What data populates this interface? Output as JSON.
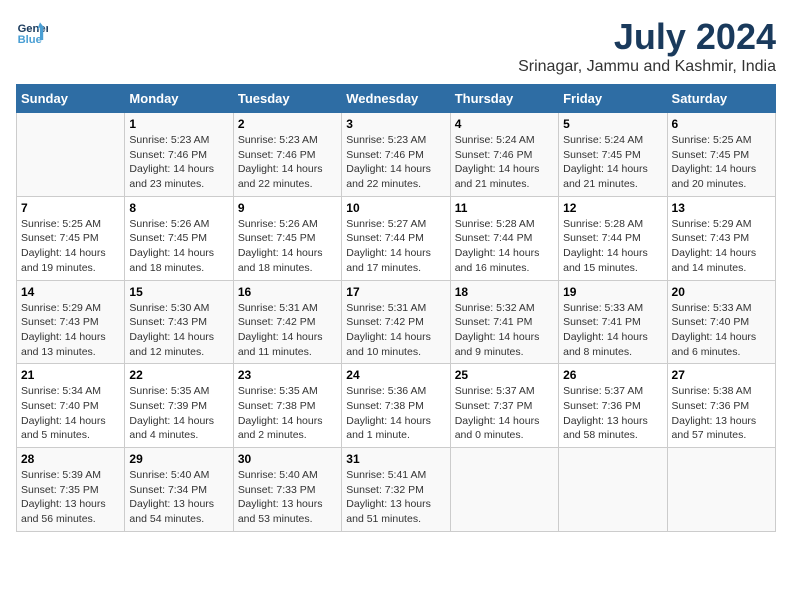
{
  "logo": {
    "line1": "General",
    "line2": "Blue"
  },
  "title": "July 2024",
  "subtitle": "Srinagar, Jammu and Kashmir, India",
  "days_of_week": [
    "Sunday",
    "Monday",
    "Tuesday",
    "Wednesday",
    "Thursday",
    "Friday",
    "Saturday"
  ],
  "weeks": [
    [
      {
        "day": "",
        "info": ""
      },
      {
        "day": "1",
        "info": "Sunrise: 5:23 AM\nSunset: 7:46 PM\nDaylight: 14 hours\nand 23 minutes."
      },
      {
        "day": "2",
        "info": "Sunrise: 5:23 AM\nSunset: 7:46 PM\nDaylight: 14 hours\nand 22 minutes."
      },
      {
        "day": "3",
        "info": "Sunrise: 5:23 AM\nSunset: 7:46 PM\nDaylight: 14 hours\nand 22 minutes."
      },
      {
        "day": "4",
        "info": "Sunrise: 5:24 AM\nSunset: 7:46 PM\nDaylight: 14 hours\nand 21 minutes."
      },
      {
        "day": "5",
        "info": "Sunrise: 5:24 AM\nSunset: 7:45 PM\nDaylight: 14 hours\nand 21 minutes."
      },
      {
        "day": "6",
        "info": "Sunrise: 5:25 AM\nSunset: 7:45 PM\nDaylight: 14 hours\nand 20 minutes."
      }
    ],
    [
      {
        "day": "7",
        "info": "Sunrise: 5:25 AM\nSunset: 7:45 PM\nDaylight: 14 hours\nand 19 minutes."
      },
      {
        "day": "8",
        "info": "Sunrise: 5:26 AM\nSunset: 7:45 PM\nDaylight: 14 hours\nand 18 minutes."
      },
      {
        "day": "9",
        "info": "Sunrise: 5:26 AM\nSunset: 7:45 PM\nDaylight: 14 hours\nand 18 minutes."
      },
      {
        "day": "10",
        "info": "Sunrise: 5:27 AM\nSunset: 7:44 PM\nDaylight: 14 hours\nand 17 minutes."
      },
      {
        "day": "11",
        "info": "Sunrise: 5:28 AM\nSunset: 7:44 PM\nDaylight: 14 hours\nand 16 minutes."
      },
      {
        "day": "12",
        "info": "Sunrise: 5:28 AM\nSunset: 7:44 PM\nDaylight: 14 hours\nand 15 minutes."
      },
      {
        "day": "13",
        "info": "Sunrise: 5:29 AM\nSunset: 7:43 PM\nDaylight: 14 hours\nand 14 minutes."
      }
    ],
    [
      {
        "day": "14",
        "info": "Sunrise: 5:29 AM\nSunset: 7:43 PM\nDaylight: 14 hours\nand 13 minutes."
      },
      {
        "day": "15",
        "info": "Sunrise: 5:30 AM\nSunset: 7:43 PM\nDaylight: 14 hours\nand 12 minutes."
      },
      {
        "day": "16",
        "info": "Sunrise: 5:31 AM\nSunset: 7:42 PM\nDaylight: 14 hours\nand 11 minutes."
      },
      {
        "day": "17",
        "info": "Sunrise: 5:31 AM\nSunset: 7:42 PM\nDaylight: 14 hours\nand 10 minutes."
      },
      {
        "day": "18",
        "info": "Sunrise: 5:32 AM\nSunset: 7:41 PM\nDaylight: 14 hours\nand 9 minutes."
      },
      {
        "day": "19",
        "info": "Sunrise: 5:33 AM\nSunset: 7:41 PM\nDaylight: 14 hours\nand 8 minutes."
      },
      {
        "day": "20",
        "info": "Sunrise: 5:33 AM\nSunset: 7:40 PM\nDaylight: 14 hours\nand 6 minutes."
      }
    ],
    [
      {
        "day": "21",
        "info": "Sunrise: 5:34 AM\nSunset: 7:40 PM\nDaylight: 14 hours\nand 5 minutes."
      },
      {
        "day": "22",
        "info": "Sunrise: 5:35 AM\nSunset: 7:39 PM\nDaylight: 14 hours\nand 4 minutes."
      },
      {
        "day": "23",
        "info": "Sunrise: 5:35 AM\nSunset: 7:38 PM\nDaylight: 14 hours\nand 2 minutes."
      },
      {
        "day": "24",
        "info": "Sunrise: 5:36 AM\nSunset: 7:38 PM\nDaylight: 14 hours\nand 1 minute."
      },
      {
        "day": "25",
        "info": "Sunrise: 5:37 AM\nSunset: 7:37 PM\nDaylight: 14 hours\nand 0 minutes."
      },
      {
        "day": "26",
        "info": "Sunrise: 5:37 AM\nSunset: 7:36 PM\nDaylight: 13 hours\nand 58 minutes."
      },
      {
        "day": "27",
        "info": "Sunrise: 5:38 AM\nSunset: 7:36 PM\nDaylight: 13 hours\nand 57 minutes."
      }
    ],
    [
      {
        "day": "28",
        "info": "Sunrise: 5:39 AM\nSunset: 7:35 PM\nDaylight: 13 hours\nand 56 minutes."
      },
      {
        "day": "29",
        "info": "Sunrise: 5:40 AM\nSunset: 7:34 PM\nDaylight: 13 hours\nand 54 minutes."
      },
      {
        "day": "30",
        "info": "Sunrise: 5:40 AM\nSunset: 7:33 PM\nDaylight: 13 hours\nand 53 minutes."
      },
      {
        "day": "31",
        "info": "Sunrise: 5:41 AM\nSunset: 7:32 PM\nDaylight: 13 hours\nand 51 minutes."
      },
      {
        "day": "",
        "info": ""
      },
      {
        "day": "",
        "info": ""
      },
      {
        "day": "",
        "info": ""
      }
    ]
  ]
}
